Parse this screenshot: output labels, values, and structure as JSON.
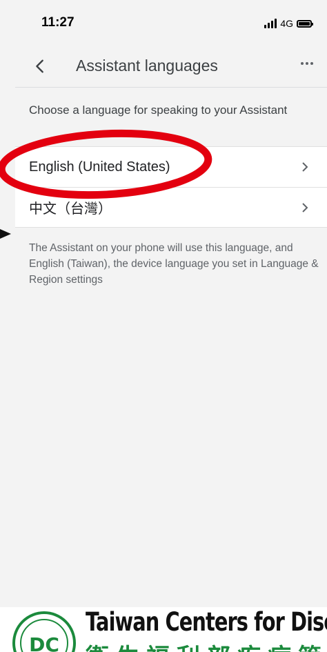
{
  "status_bar": {
    "time": "11:27",
    "network": "4G"
  },
  "app_bar": {
    "title": "Assistant languages",
    "back_icon": "chevron-left-icon",
    "more_icon": "more-horizontal-icon"
  },
  "description": "Choose a language for speaking to your Assistant",
  "languages": [
    {
      "label": "English (United States)"
    },
    {
      "label": "中文（台灣）"
    }
  ],
  "footer_note": "The Assistant on your phone will use this language, and English (Taiwan), the device language you set in Language & Region settings",
  "annotation": {
    "color": "#e3000f"
  },
  "banner": {
    "title": "Taiwan Centers for Disease C",
    "subtitle": "衛生福利部疾病管",
    "logo_text": "DC",
    "accent": "#1b8a3c"
  }
}
